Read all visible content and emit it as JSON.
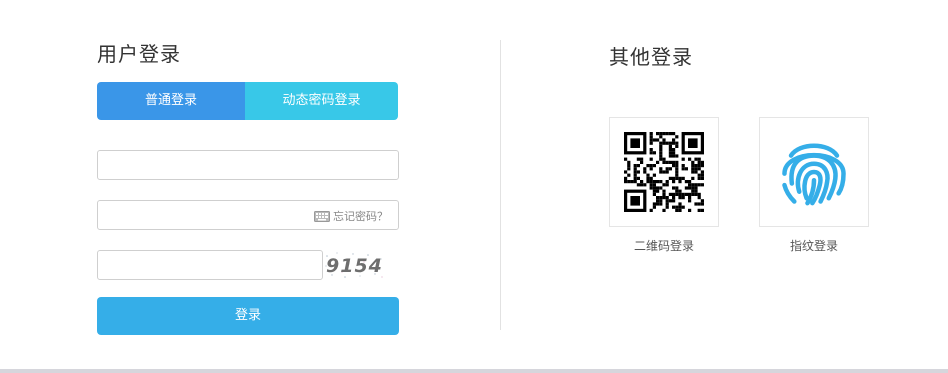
{
  "user_login": {
    "title": "用户登录",
    "tabs": [
      {
        "label": "普通登录",
        "color": "#3a96e8"
      },
      {
        "label": "动态密码登录",
        "color": "#38c8e8"
      }
    ],
    "username": {
      "value": "",
      "placeholder": ""
    },
    "password": {
      "value": "",
      "placeholder": "",
      "forgot_label": "忘记密码？",
      "keyboard_icon": "keyboard-icon"
    },
    "captcha": {
      "value": "",
      "placeholder": "",
      "code": "9154"
    },
    "submit_label": "登录",
    "submit_color": "#35aee8"
  },
  "other_login": {
    "title": "其他登录",
    "options": [
      {
        "label": "二维码登录",
        "icon": "qr-code-icon"
      },
      {
        "label": "指纹登录",
        "icon": "fingerprint-icon",
        "color": "#35aee8"
      }
    ]
  }
}
